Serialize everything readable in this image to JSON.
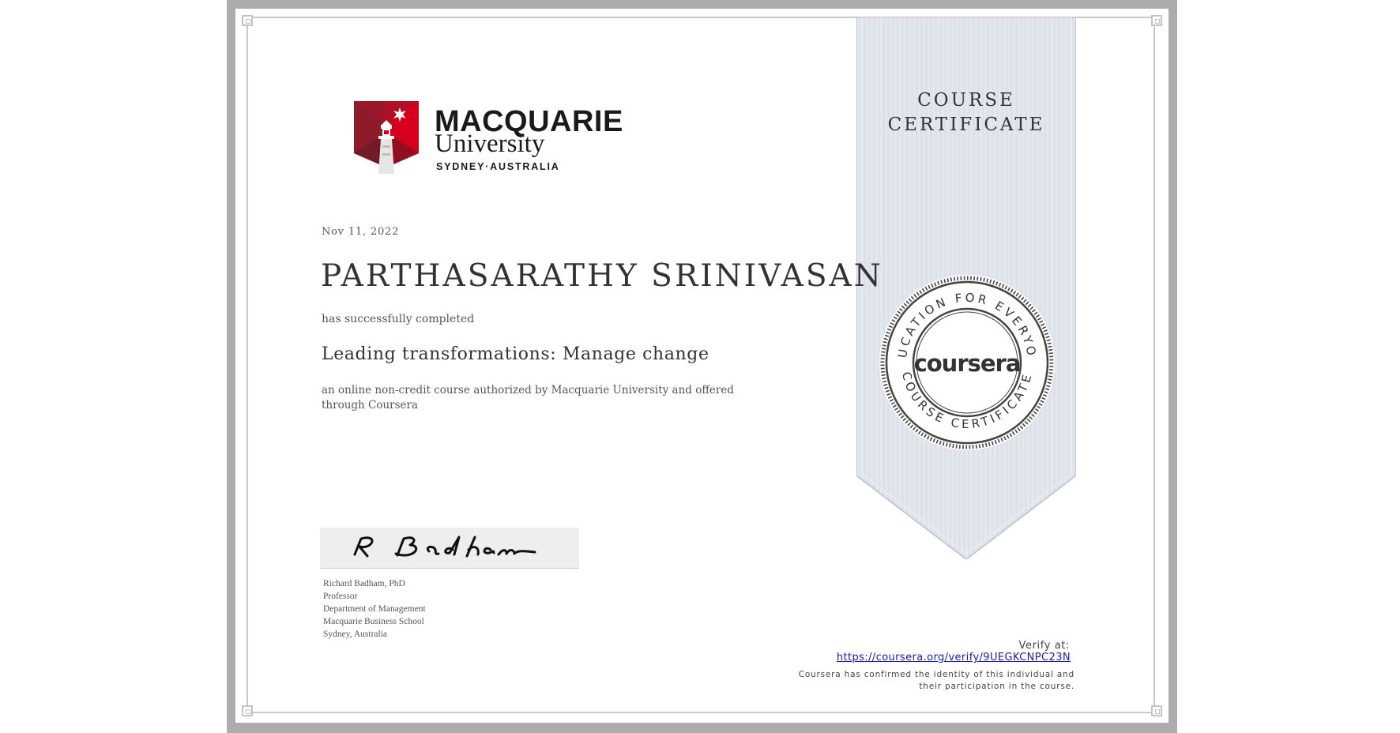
{
  "logo": {
    "line1": "MACQUARIE",
    "line2": "University",
    "line3": "SYDNEY·AUSTRALIA",
    "brand_red": "#d6001c",
    "dark_red": "#76232f"
  },
  "ribbon": {
    "title_line1": "COURSE",
    "title_line2": "CERTIFICATE",
    "color": "#dee3eb"
  },
  "seal": {
    "arc_top": "EDUCATION FOR EVERYONE",
    "arc_bottom": "COURSE CERTIFICATE",
    "brand": "coursera"
  },
  "certificate": {
    "date": "Nov 11, 2022",
    "recipient": "PARTHASARATHY SRINIVASAN",
    "completed_label": "has successfully completed",
    "course": "Leading transformations: Manage change",
    "description": "an online non-credit course authorized by Macquarie University and offered through Coursera"
  },
  "signature": {
    "signed": "R Badham",
    "lines": [
      "Richard Badham, PhD",
      "Professor",
      "Department of Management",
      "Macquarie Business School",
      "Sydney, Australia"
    ]
  },
  "verify": {
    "label": "Verify at:",
    "url": "https://coursera.org/verify/9UEGKCNPC23N",
    "note_line1": "Coursera has confirmed the identity of this individual and",
    "note_line2": "their participation in the course."
  }
}
